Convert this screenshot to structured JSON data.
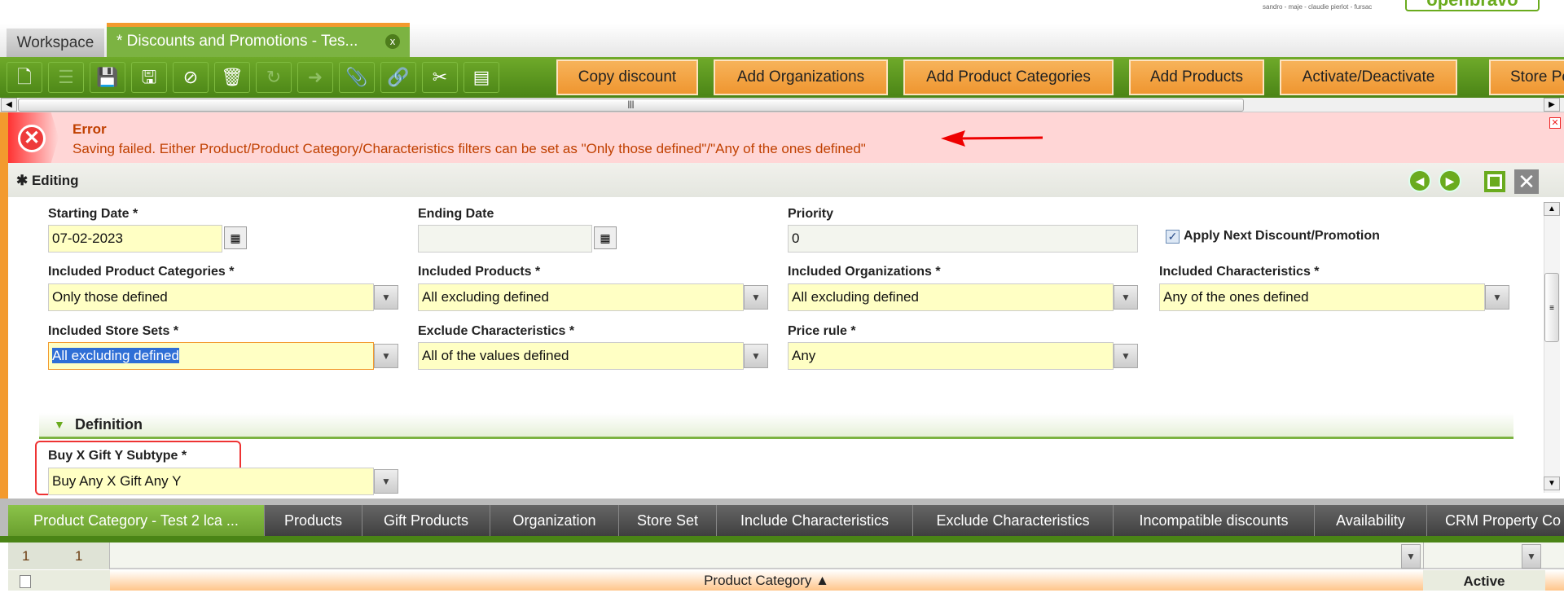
{
  "branding": {
    "tagline": "sandro - maje - claudie pierlot - fursac",
    "logo": "openbravo"
  },
  "tabs": {
    "workspace": "Workspace",
    "active": "* Discounts and Promotions - Tes...",
    "close": "x"
  },
  "toolbar": {
    "buttons": [
      "Copy discount",
      "Add Organizations",
      "Add Product Categories",
      "Add Products",
      "Activate/Deactivate",
      "Store Pe"
    ]
  },
  "error": {
    "title": "Error",
    "message": "Saving failed. Either Product/Product Category/Characteristics filters can be set as \"Only those defined\"/\"Any of the ones defined\""
  },
  "form": {
    "header": "Editing",
    "starting_date": {
      "label": "Starting Date *",
      "value": "07-02-2023"
    },
    "ending_date": {
      "label": "Ending Date",
      "value": ""
    },
    "priority": {
      "label": "Priority",
      "value": "0"
    },
    "apply_next": {
      "label": "Apply Next Discount/Promotion",
      "checked": true
    },
    "included_product_categories": {
      "label": "Included Product Categories *",
      "value": "Only those defined"
    },
    "included_products": {
      "label": "Included Products *",
      "value": "All excluding defined"
    },
    "included_organizations": {
      "label": "Included Organizations *",
      "value": "All excluding defined"
    },
    "included_characteristics": {
      "label": "Included Characteristics *",
      "value": "Any of the ones defined"
    },
    "included_store_sets": {
      "label": "Included Store Sets *",
      "value": "All excluding defined"
    },
    "exclude_characteristics": {
      "label": "Exclude Characteristics *",
      "value": "All of the values defined"
    },
    "price_rule": {
      "label": "Price rule *",
      "value": "Any"
    },
    "definition": "Definition",
    "buy_x_gift_y": {
      "label": "Buy X Gift Y Subtype *",
      "value": "Buy Any X Gift Any Y"
    }
  },
  "subtabs": [
    "Product Category - Test 2 lca ...",
    "Products",
    "Gift Products",
    "Organization",
    "Store Set",
    "Include Characteristics",
    "Exclude Characteristics",
    "Incompatible discounts",
    "Availability",
    "CRM Property Co"
  ],
  "grid": {
    "count_selected": "1",
    "count_total": "1",
    "columns": [
      "Product Category ▲",
      "Active"
    ]
  }
}
